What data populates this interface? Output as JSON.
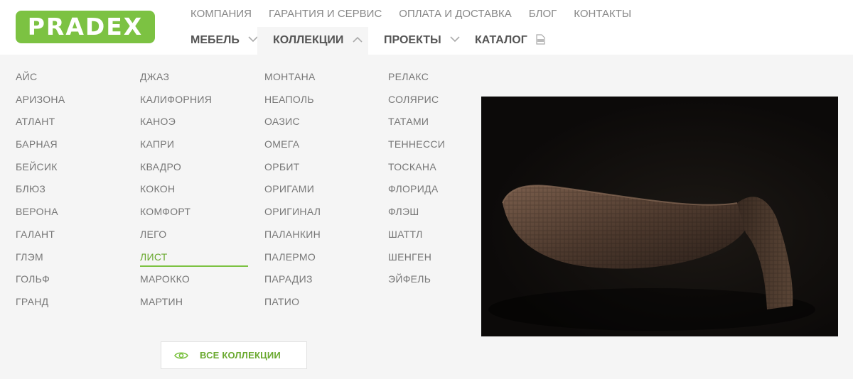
{
  "brand": {
    "logo_text": "PRADEX",
    "accent": "#7cc242"
  },
  "topnav": [
    {
      "label": "КОМПАНИЯ"
    },
    {
      "label": "ГАРАНТИЯ И СЕРВИС"
    },
    {
      "label": "ОПЛАТА И ДОСТАВКА"
    },
    {
      "label": "БЛОГ"
    },
    {
      "label": "КОНТАКТЫ"
    }
  ],
  "mainnav": [
    {
      "label": "МЕБЕЛЬ",
      "icon": "chevron-down-icon"
    },
    {
      "label": "КОЛЛЕКЦИИ",
      "icon": "chevron-up-icon",
      "active": true
    },
    {
      "label": "ПРОЕКТЫ",
      "icon": "chevron-down-icon"
    },
    {
      "label": "КАТАЛОГ",
      "icon": "pdf-icon"
    }
  ],
  "collections": {
    "col1": [
      "АЙС",
      "АРИЗОНА",
      "АТЛАНТ",
      "БАРНАЯ",
      "БЕЙСИК",
      "БЛЮЗ",
      "ВЕРОНА",
      "ГАЛАНТ",
      "ГЛЭМ",
      "ГОЛЬФ",
      "ГРАНД"
    ],
    "col2": [
      "ДЖАЗ",
      "КАЛИФОРНИЯ",
      "КАНОЭ",
      "КАПРИ",
      "КВАДРО",
      "КОКОН",
      "КОМФОРТ",
      "ЛЕГО",
      "ЛИСТ",
      "МАРОККО",
      "МАРТИН"
    ],
    "col3": [
      "МОНТАНА",
      "НЕАПОЛЬ",
      "ОАЗИС",
      "ОМЕГА",
      "ОРБИТ",
      "ОРИГАМИ",
      "ОРИГИНАЛ",
      "ПАЛАНКИН",
      "ПАЛЕРМО",
      "ПАРАДИЗ",
      "ПАТИО"
    ],
    "col4": [
      "РЕЛАКС",
      "СОЛЯРИС",
      "ТАТАМИ",
      "ТЕННЕССИ",
      "ТОСКАНА",
      "ФЛОРИДА",
      "ФЛЭШ",
      "ШАТТЛ",
      "ШЕНГЕН",
      "ЭЙФЕЛЬ"
    ],
    "active_item": "ЛИСТ"
  },
  "all_button": {
    "label": "ВСЕ КОЛЛЕКЦИИ",
    "icon": "eye-icon"
  }
}
